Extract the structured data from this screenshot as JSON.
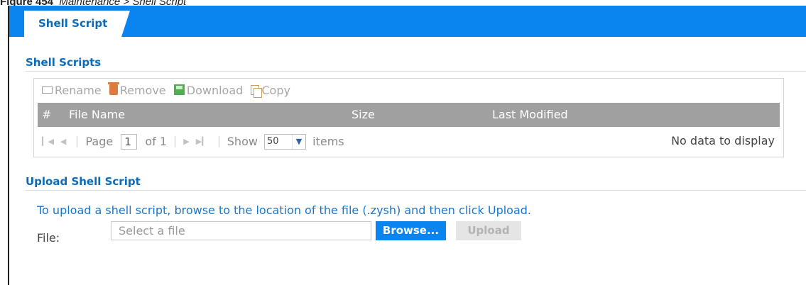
{
  "figure_caption": {
    "label": "Figure 454",
    "title": "Maintenance > Shell Script"
  },
  "tabs": [
    {
      "label": "Shell Script",
      "active": true
    }
  ],
  "shell_scripts": {
    "section_title": "Shell Scripts",
    "toolbar": {
      "rename_label": "Rename",
      "remove_label": "Remove",
      "download_label": "Download",
      "copy_label": "Copy"
    },
    "columns": [
      "#",
      "File Name",
      "Size",
      "Last Modified"
    ],
    "rows": [],
    "pager": {
      "page_label": "Page",
      "page_value": "1",
      "of_label": "of 1",
      "show_label": "Show",
      "show_value": "50",
      "items_label": "items",
      "empty_text": "No data to display"
    }
  },
  "upload": {
    "section_title": "Upload Shell Script",
    "description": "To upload a shell script, browse to the location of the file (.zysh) and then click Upload.",
    "file_label": "File:",
    "file_placeholder": "Select a file",
    "browse_label": "Browse...",
    "upload_label": "Upload"
  },
  "colors": {
    "accent": "#0a84ef",
    "section_title": "#0b6bb8",
    "header_row": "#a0a0a0",
    "disabled_text": "#a7a7a7"
  },
  "icons": {
    "rename": "rename-icon",
    "remove": "trash-icon",
    "download": "save-disk-icon",
    "copy": "copy-icon",
    "first": "first-page-icon",
    "prev": "prev-page-icon",
    "next": "next-page-icon",
    "last": "last-page-icon",
    "dropdown": "chevron-down-icon"
  }
}
